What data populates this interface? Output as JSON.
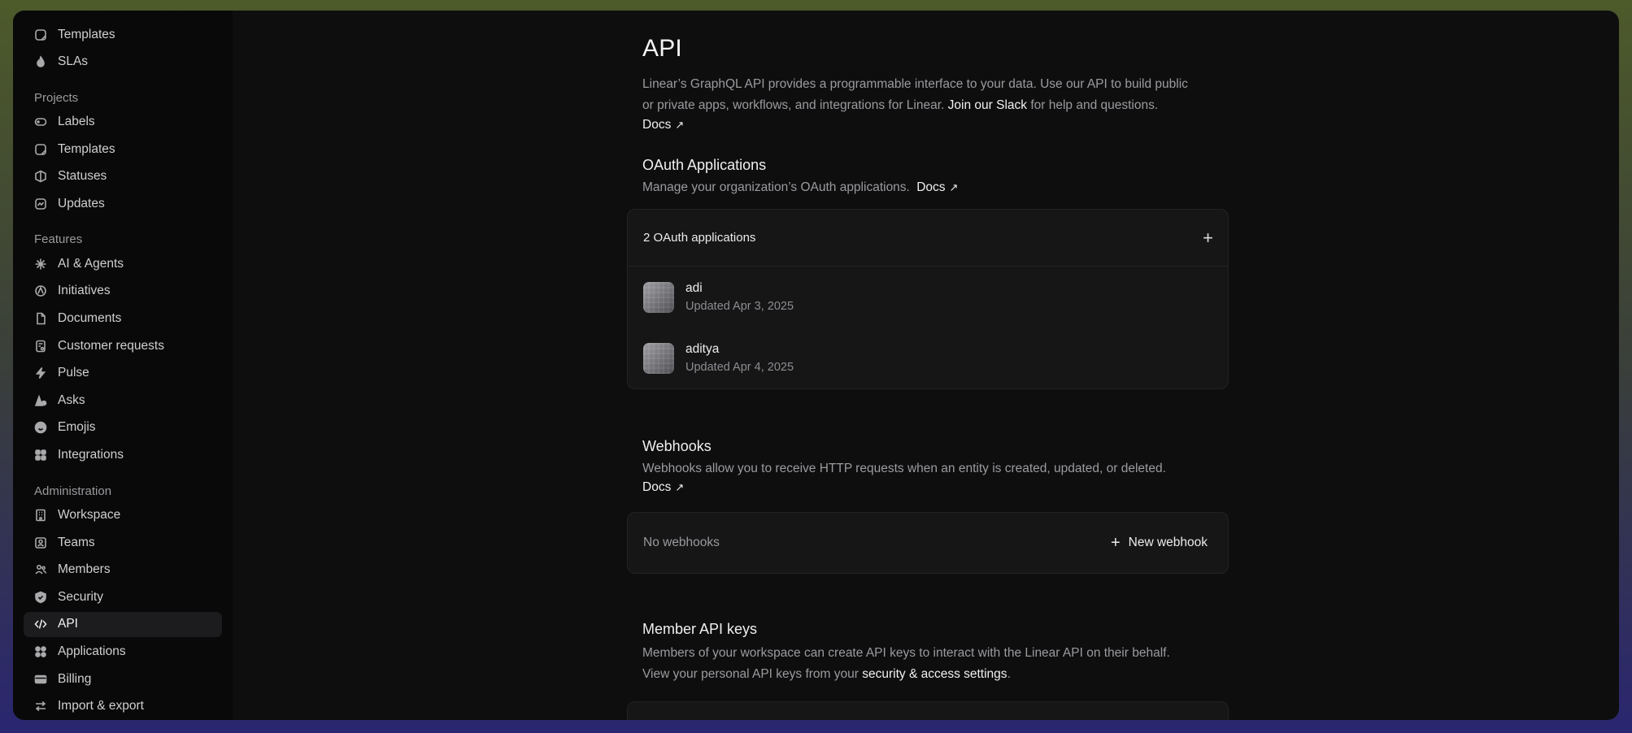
{
  "sidebar": {
    "top_items": [
      {
        "label": "Templates",
        "icon": "template-icon"
      },
      {
        "label": "SLAs",
        "icon": "flame-icon"
      }
    ],
    "sections": [
      {
        "title": "Projects",
        "items": [
          {
            "label": "Labels",
            "icon": "label-icon"
          },
          {
            "label": "Templates",
            "icon": "template-icon"
          },
          {
            "label": "Statuses",
            "icon": "status-icon"
          },
          {
            "label": "Updates",
            "icon": "updates-icon"
          }
        ]
      },
      {
        "title": "Features",
        "items": [
          {
            "label": "AI & Agents",
            "icon": "sparkle-icon"
          },
          {
            "label": "Initiatives",
            "icon": "initiative-icon"
          },
          {
            "label": "Documents",
            "icon": "document-icon"
          },
          {
            "label": "Customer requests",
            "icon": "customer-request-icon"
          },
          {
            "label": "Pulse",
            "icon": "pulse-icon"
          },
          {
            "label": "Asks",
            "icon": "asks-icon"
          },
          {
            "label": "Emojis",
            "icon": "emoji-icon"
          },
          {
            "label": "Integrations",
            "icon": "integrations-icon"
          }
        ]
      },
      {
        "title": "Administration",
        "items": [
          {
            "label": "Workspace",
            "icon": "building-icon"
          },
          {
            "label": "Teams",
            "icon": "teams-icon"
          },
          {
            "label": "Members",
            "icon": "members-icon"
          },
          {
            "label": "Security",
            "icon": "shield-icon"
          },
          {
            "label": "API",
            "icon": "code-icon",
            "active": true
          },
          {
            "label": "Applications",
            "icon": "applications-icon"
          },
          {
            "label": "Billing",
            "icon": "billing-icon"
          },
          {
            "label": "Import & export",
            "icon": "import-export-icon"
          }
        ]
      }
    ]
  },
  "api": {
    "title": "API",
    "intro_1": "Linear’s GraphQL API provides a programmable interface to your data. Use our API to build public",
    "intro_2": "or private apps, workflows, and integrations for Linear.",
    "slack_link": "Join our Slack",
    "intro_3": "for help and questions.",
    "docs": "Docs"
  },
  "oauth": {
    "title": "OAuth Applications",
    "description": "Manage your organization’s OAuth applications.",
    "docs": "Docs",
    "count_label": "2 OAuth applications",
    "apps": [
      {
        "name": "adi",
        "updated": "Updated Apr 3, 2025"
      },
      {
        "name": "aditya",
        "updated": "Updated Apr 4, 2025"
      }
    ]
  },
  "webhooks": {
    "title": "Webhooks",
    "description": "Webhooks allow you to receive HTTP requests when an entity is created, updated, or deleted.",
    "docs": "Docs",
    "empty_label": "No webhooks",
    "new_label": "New webhook"
  },
  "member_keys": {
    "title": "Member API keys",
    "line_1": "Members of your workspace can create API keys to interact with the Linear API on their behalf.",
    "line_2": "View your personal API keys from your",
    "link": "security & access settings",
    "line_2_end": "."
  }
}
